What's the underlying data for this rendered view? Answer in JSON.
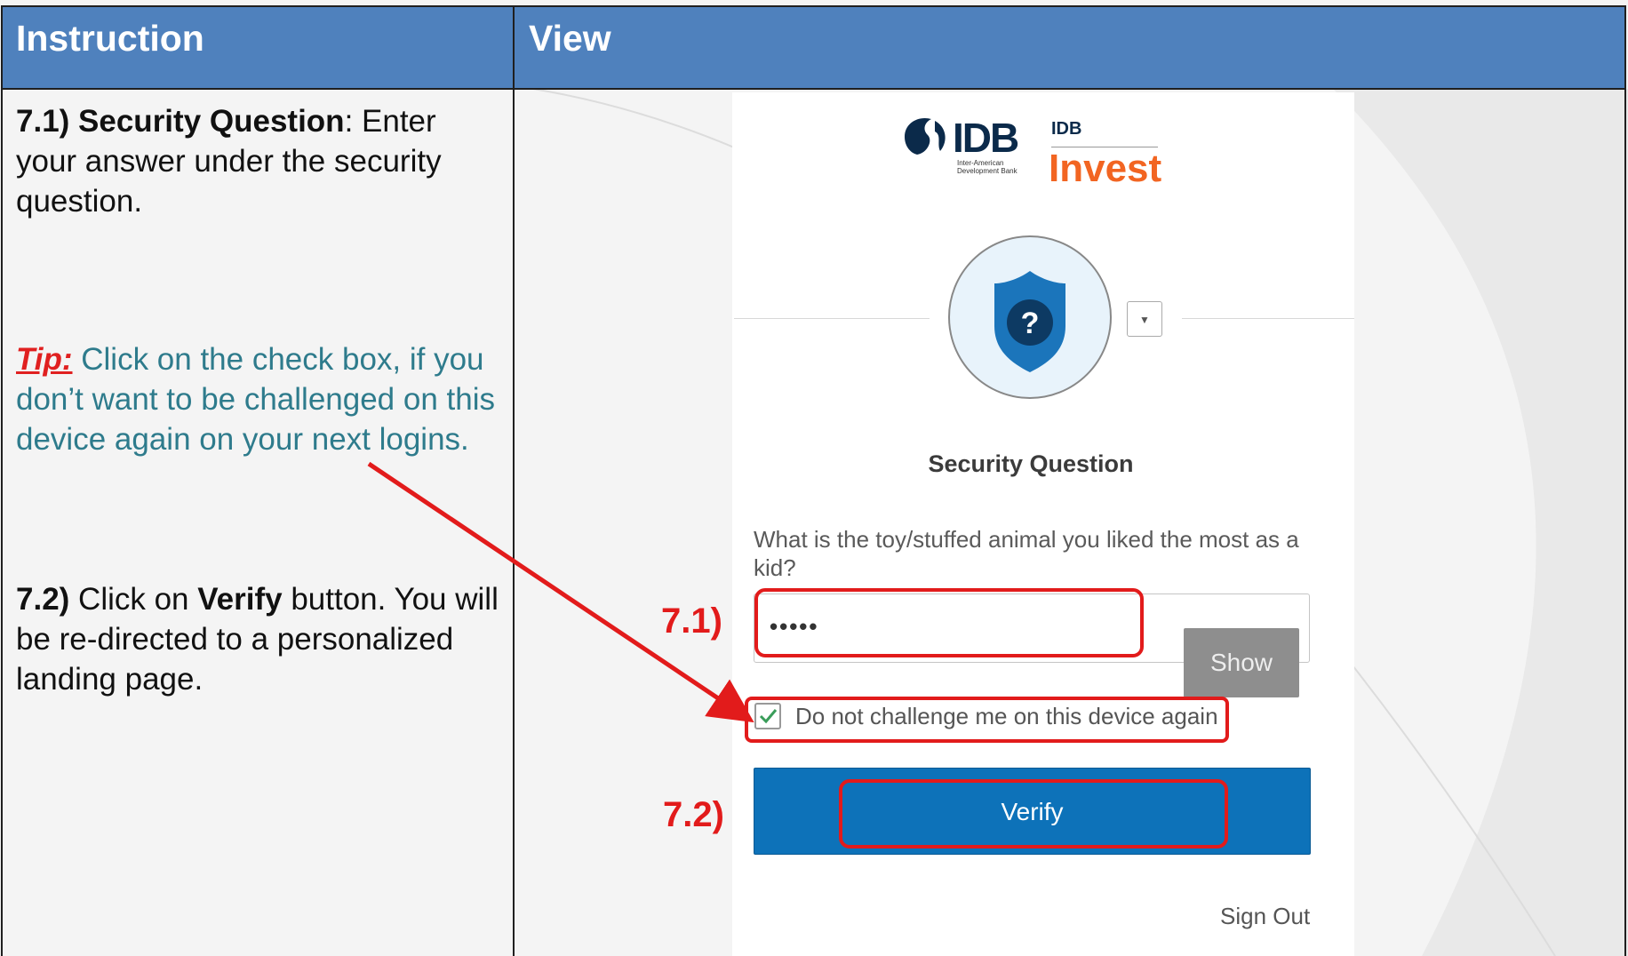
{
  "header": {
    "col_instruction": "Instruction",
    "col_view": "View"
  },
  "instructions": {
    "step1_label": "7.1) Security Question",
    "step1_text": ": Enter your answer under the security question.",
    "tip_label": "Tip:",
    "tip_text": " Click on the check box, if you don’t want to be challenged on this device again on your next logins.",
    "step2_label": "7.2)",
    "step2_text_a": " Click on ",
    "step2_bold": "Verify",
    "step2_text_b": " button. You will be re-directed to a personalized landing page."
  },
  "login": {
    "logo_idb": "IDB",
    "logo_idb_sub": "Inter-American Development Bank",
    "logo_invest_mark": "IDB",
    "logo_invest": "Invest",
    "factor_icon": "shield-question-icon",
    "title": "Security Question",
    "question": "What is the toy/stuffed animal you liked the most as a kid?",
    "answer_value": "•••••",
    "show_label": "Show",
    "remember_label": "Do not challenge me on this device again",
    "remember_checked": true,
    "verify_label": "Verify",
    "sign_out_label": "Sign Out"
  },
  "annotations": {
    "step_71": "7.1)",
    "step_72": "7.2)",
    "color": "#e21b1b"
  },
  "colors": {
    "header_bg": "#4f81bd",
    "tip_text": "#2e7b8c",
    "verify_bg": "#0d72b9",
    "invest_orange": "#f26522"
  }
}
